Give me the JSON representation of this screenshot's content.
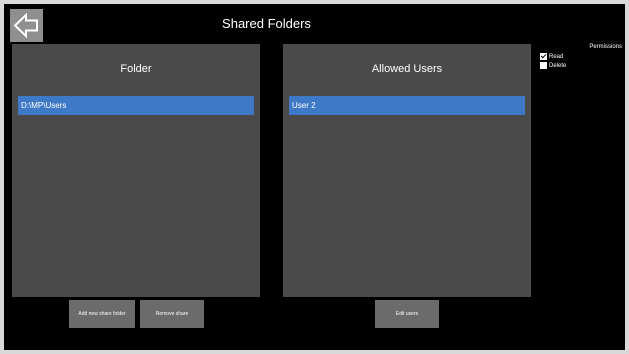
{
  "header": {
    "title": "Shared Folders",
    "back_icon": "back-arrow-icon"
  },
  "folder_panel": {
    "title": "Folder",
    "items": [
      {
        "label": "D:\\MP\\Users"
      }
    ]
  },
  "users_panel": {
    "title": "Allowed Users",
    "items": [
      {
        "label": "User 2"
      }
    ]
  },
  "buttons": {
    "add_folder": "Add new share folder",
    "remove": "Remove share",
    "edit_users": "Edit users"
  },
  "permissions": {
    "title": "Permissions",
    "options": [
      {
        "label": "Read",
        "checked": true
      },
      {
        "label": "Delete",
        "checked": false
      }
    ]
  },
  "colors": {
    "background": "#000000",
    "panel": "#4a4a4a",
    "selection": "#3e79c7",
    "button": "#6b6b6b"
  }
}
